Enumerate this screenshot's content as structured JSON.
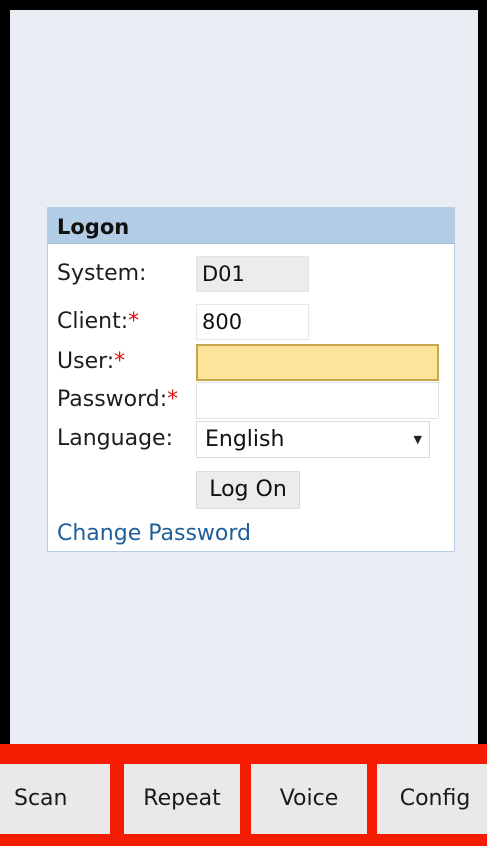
{
  "panel": {
    "title": "Logon"
  },
  "fields": {
    "system_label": "System:",
    "system_value": "D01",
    "client_label": "Client:",
    "client_value": "800",
    "user_label": "User:",
    "user_value": "",
    "password_label": "Password:",
    "password_value": "",
    "language_label": "Language:",
    "language_value": "English",
    "required_mark": "*"
  },
  "actions": {
    "logon": "Log On",
    "change_password": "Change Password"
  },
  "footer": {
    "buttons": [
      "Scan",
      "Repeat",
      "Voice",
      "Config"
    ]
  },
  "colors": {
    "accent_red": "#f41d04",
    "panel_header": "#b4cde6",
    "focused_field": "#fde49b",
    "link": "#1f5f99"
  },
  "icons": {
    "dropdown": "chevron-down-icon"
  }
}
